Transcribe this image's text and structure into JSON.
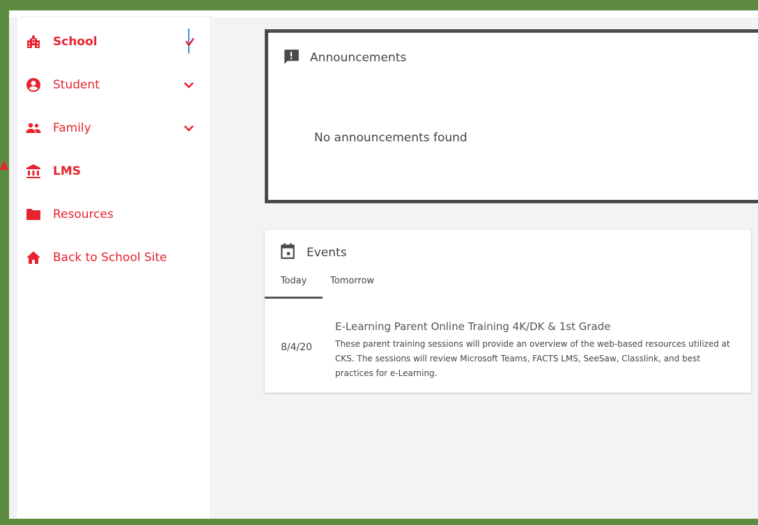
{
  "sidebar": {
    "items": [
      {
        "label": "School",
        "icon": "school-building-icon",
        "bold": true
      },
      {
        "label": "Student",
        "icon": "account-circle-icon",
        "expandable": true
      },
      {
        "label": "Family",
        "icon": "people-icon",
        "expandable": true
      },
      {
        "label": "LMS",
        "icon": "institution-icon",
        "bold": true
      },
      {
        "label": "Resources",
        "icon": "folder-icon"
      },
      {
        "label": "Back to School Site",
        "icon": "home-icon"
      }
    ]
  },
  "announcements": {
    "title": "Announcements",
    "icon": "announcement-icon",
    "empty_message": "No announcements found"
  },
  "events": {
    "title": "Events",
    "icon": "calendar-icon",
    "tabs": [
      "Today",
      "Tomorrow"
    ],
    "active_tab": "Today",
    "items": [
      {
        "date": "8/4/20",
        "title": "E-Learning Parent Online Training 4K/DK & 1st Grade",
        "description": "These parent training sessions will provide an overview of the web-based resources utilized at CKS. The sessions will review Microsoft Teams, FACTS LMS, SeeSaw, Classlink, and best practices for e-Learning."
      }
    ]
  },
  "colors": {
    "accent": "#e8232f",
    "frame": "#5d8c41",
    "card_border": "#4a4a4a",
    "background": "#f4f3f3"
  }
}
